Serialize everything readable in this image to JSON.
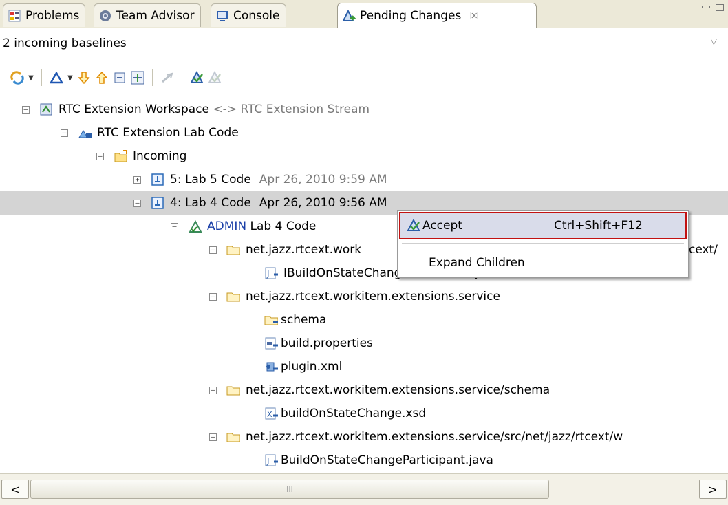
{
  "tabs": [
    {
      "label": "Problems",
      "icon": "problems-icon"
    },
    {
      "label": "Team Advisor",
      "icon": "team-advisor-icon"
    },
    {
      "label": "Console",
      "icon": "console-icon"
    },
    {
      "label": "Pending Changes",
      "icon": "pending-changes-icon",
      "active": true,
      "close": "☒"
    }
  ],
  "view_title": "2 incoming baselines",
  "toolbar_icons": [
    "sync-icon",
    "dropdown-icon",
    "delta-icon",
    "dropdown-icon",
    "arrow-down-icon",
    "arrow-up-icon",
    "collapse-all-icon",
    "expand-icon",
    "flow-icon",
    "accept-icon",
    "accept-all-icon"
  ],
  "tree": {
    "workspace": {
      "name": "RTC Extension Workspace",
      "arrow": "<->",
      "stream": "RTC Extension Stream"
    },
    "component": "RTC Extension Lab Code",
    "incoming": "Incoming",
    "baseline5": {
      "label": "5: Lab 5 Code",
      "date": "Apr 26, 2010 9:59 AM"
    },
    "baseline4": {
      "label": "4: Lab 4 Code",
      "date": "Apr 26, 2010 9:56 AM"
    },
    "changeset": {
      "author": "ADMIN",
      "comment": "Lab 4 Code"
    },
    "folder1": {
      "name": "net.jazz.rtcext.work",
      "tail": "cext/"
    },
    "file1": "IBuildOnStateChangeDefinitions.java",
    "folder2": "net.jazz.rtcext.workitem.extensions.service",
    "file2": "schema",
    "file3": "build.properties",
    "file4": "plugin.xml",
    "folder3": "net.jazz.rtcext.workitem.extensions.service/schema",
    "file5": "buildOnStateChange.xsd",
    "folder4": "net.jazz.rtcext.workitem.extensions.service/src/net/jazz/rtcext/w",
    "file6": "BuildOnStateChangeParticipant.java"
  },
  "context_menu": {
    "accept_label": "Accept",
    "accept_shortcut": "Ctrl+Shift+F12",
    "expand_label": "Expand Children"
  },
  "scrollbar": {
    "left": "<",
    "right": ">",
    "grip": "III"
  },
  "colors": {
    "selection": "#d4d4d4",
    "menu_highlight": "#d9dcea",
    "highlight_border": "#c21212",
    "author": "#1a3fa8"
  }
}
